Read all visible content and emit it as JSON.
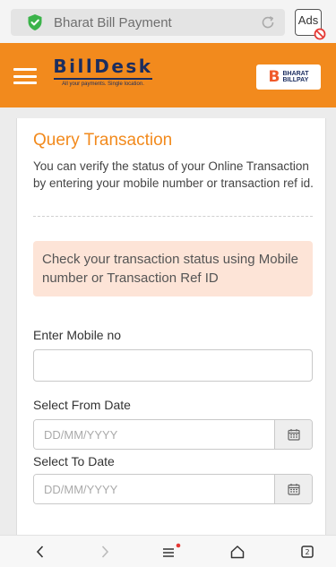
{
  "browser": {
    "url_text": "Bharat Bill Payment",
    "ads_label": "Ads"
  },
  "header": {
    "logo_main": "BillDesk",
    "logo_tagline": "All your payments. Single location.",
    "bbps_letter": "B",
    "bbps_line1": "BHARAT",
    "bbps_line2": "BILLPAY"
  },
  "main": {
    "title": "Query Transaction",
    "description": "You can verify the status of your Online Transaction by entering your mobile number or transaction ref id.",
    "info_text": "Check your transaction status using Mobile number or Transaction Ref ID",
    "mobile_label": "Enter Mobile no",
    "mobile_value": "",
    "from_label": "Select From Date",
    "from_placeholder": "DD/MM/YYYY",
    "to_label": "Select To Date",
    "to_placeholder": "DD/MM/YYYY"
  },
  "colors": {
    "brand_orange": "#f28a1d",
    "brand_navy": "#1b2d5f",
    "info_bg": "#fde4d7",
    "secure_green": "#3bb34a"
  },
  "icons": {
    "secure": "shield-check-icon",
    "reload": "reload-icon",
    "ads_block": "ads-block-icon",
    "menu": "hamburger-menu-icon",
    "calendar": "calendar-icon",
    "back": "chevron-left-icon",
    "forward": "chevron-right-icon",
    "tabs_menu": "menu-icon",
    "home": "home-icon",
    "tabs": "tabs-icon"
  }
}
